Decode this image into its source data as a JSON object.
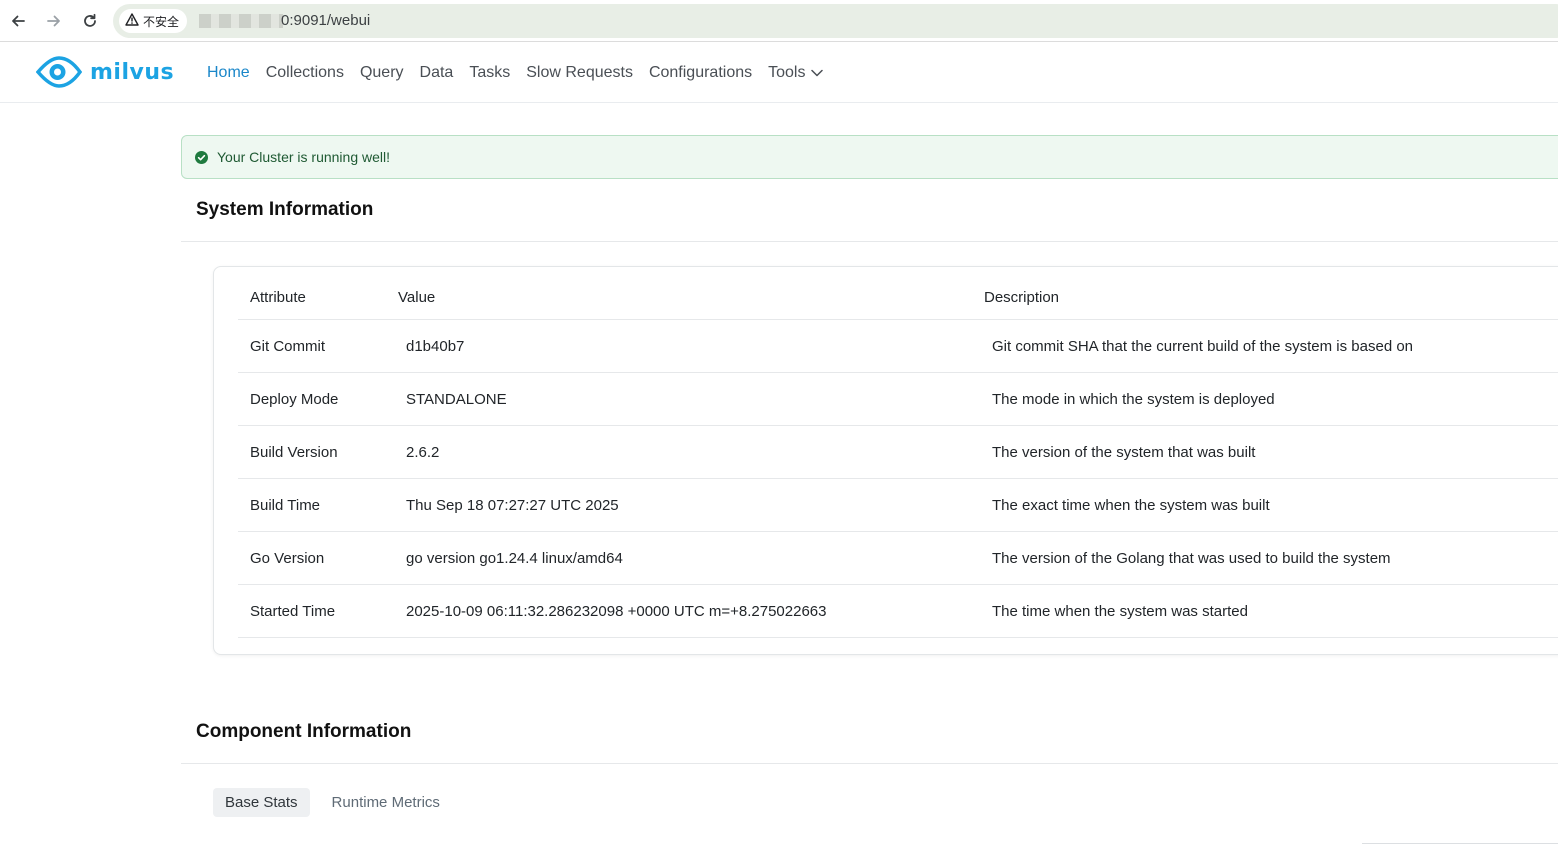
{
  "browser": {
    "security_label": "不安全",
    "url_visible": "0:9091/webui"
  },
  "app": {
    "logo_text": "milvus",
    "brand_color": "#1ca3e3",
    "nav": [
      {
        "label": "Home",
        "active": true
      },
      {
        "label": "Collections"
      },
      {
        "label": "Query"
      },
      {
        "label": "Data"
      },
      {
        "label": "Tasks"
      },
      {
        "label": "Slow Requests"
      },
      {
        "label": "Configurations"
      },
      {
        "label": "Tools",
        "has_dropdown": true
      }
    ]
  },
  "alert": {
    "message": "Your Cluster is running well!",
    "icon": "check-circle-icon",
    "color": "#1f7a3f"
  },
  "system_info": {
    "title": "System Information",
    "headers": {
      "attribute": "Attribute",
      "value": "Value",
      "description": "Description"
    },
    "rows": [
      {
        "attribute": "Git Commit",
        "value": "d1b40b7",
        "description": "Git commit SHA that the current build of the system is based on"
      },
      {
        "attribute": "Deploy Mode",
        "value": "STANDALONE",
        "description": "The mode in which the system is deployed"
      },
      {
        "attribute": "Build Version",
        "value": "2.6.2",
        "description": "The version of the system that was built"
      },
      {
        "attribute": "Build Time",
        "value": "Thu Sep 18 07:27:27 UTC 2025",
        "description": "The exact time when the system was built"
      },
      {
        "attribute": "Go Version",
        "value": "go version go1.24.4 linux/amd64",
        "description": "The version of the Golang that was used to build the system"
      },
      {
        "attribute": "Started Time",
        "value": "2025-10-09 06:11:32.286232098 +0000 UTC m=+8.275022663",
        "description": "The time when the system was started"
      }
    ]
  },
  "component_info": {
    "title": "Component Information",
    "tabs": [
      {
        "label": "Base Stats",
        "active": true
      },
      {
        "label": "Runtime Metrics"
      }
    ]
  }
}
